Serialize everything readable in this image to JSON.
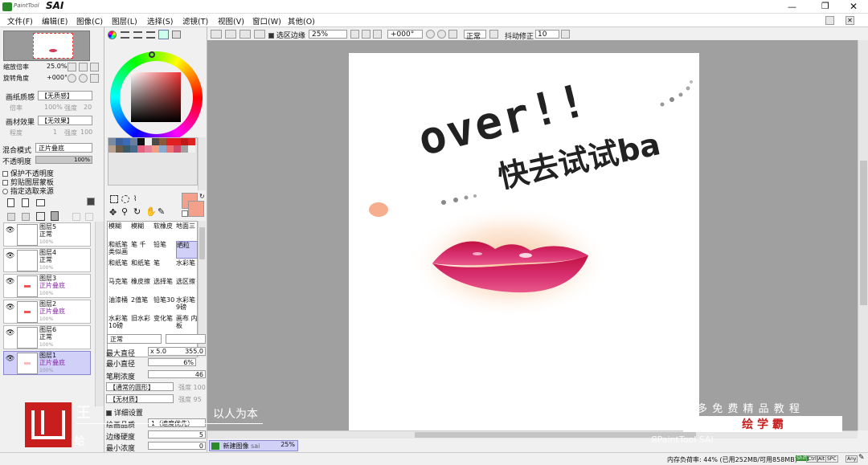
{
  "title": {
    "logo_small": "PaintTool",
    "logo_big": "SAI"
  },
  "menu": [
    "文件(F)",
    "编辑(E)",
    "图像(C)",
    "图层(L)",
    "选择(S)",
    "滤镜(T)",
    "视图(V)",
    "窗口(W)",
    "其他(O)"
  ],
  "navigator": {
    "zoom_label": "缩放倍率",
    "zoom_value": "25.0%",
    "rotate_label": "旋转角度",
    "rotate_value": "+000°"
  },
  "paper_texture": {
    "label": "画纸质感",
    "value": "【无质感】",
    "scale_label": "倍率",
    "scale_value": "100%",
    "strength_label": "强度",
    "strength_value": "20"
  },
  "paper_effect": {
    "label": "画材效果",
    "value": "【无效果】",
    "width_label": "程度",
    "width_value": "1",
    "strength_label": "强度",
    "strength_value": "100"
  },
  "blend": {
    "label": "混合模式",
    "value": "正片叠底",
    "opacity_label": "不透明度",
    "opacity_value": "100%"
  },
  "checks": [
    "保护不透明度",
    "剪贴图层蒙板",
    "指定选取来源"
  ],
  "layers": [
    {
      "name": "图层5",
      "mode": "正常",
      "opacity": "100%",
      "purple": false
    },
    {
      "name": "图层4",
      "mode": "正常",
      "opacity": "100%",
      "purple": false
    },
    {
      "name": "图层3",
      "mode": "正片叠底",
      "opacity": "100%",
      "purple": true
    },
    {
      "name": "图层2",
      "mode": "正片叠底",
      "opacity": "100%",
      "purple": true
    },
    {
      "name": "图层6",
      "mode": "正常",
      "opacity": "100%",
      "purple": false
    },
    {
      "name": "图层1",
      "mode": "正片叠底",
      "opacity": "100%",
      "purple": true
    }
  ],
  "tools": [
    [
      "模糊",
      "模糊",
      "软橡皮",
      "地面三"
    ],
    [
      "和纸笔 类似画",
      "笔 千",
      "铅笔",
      "晒粒"
    ],
    [
      "和纸笔",
      "和纸笔",
      "笔",
      "水彩笔"
    ],
    [
      "马克笔",
      "橡皮擦",
      "选择笔",
      "选区擦"
    ],
    [
      "油漆桶",
      "2值笔",
      "铅笔30",
      "水彩笔 9磅"
    ],
    [
      "水彩笔 10磅",
      "旧水彩",
      "变化笔",
      "画布 内板"
    ]
  ],
  "brush": {
    "mode": "正常",
    "max_size_label": "最大直径",
    "max_size_mult": "x 5.0",
    "max_size_value": "355.0",
    "min_size_label": "最小直径",
    "min_size_value": "6%",
    "density_label": "笔刷浓度",
    "density_value": "46",
    "shape_value": "【通常的圆形】",
    "shape_strength": "强度 100",
    "texture_value": "【无材质】",
    "texture_strength": "强度 95",
    "detail_label": "详细设置",
    "quality_label": "绘画品质",
    "quality_value": "1（速度优先）",
    "edge_label": "边缘硬度",
    "edge_value": "5",
    "min_density_label": "最小浓度",
    "min_density_value": "0"
  },
  "toolbar": {
    "selection_edge": "选区边缘",
    "zoom": "25%",
    "angle": "+000°",
    "mode": "正常",
    "stabilizer_label": "抖动修正",
    "stabilizer_value": "10"
  },
  "doc_tab": {
    "name": "新建图像",
    "zoom": "25%",
    "flag": "sai"
  },
  "status": {
    "memory": "内存负荷率: 44% (已用252MB/可用858MB)",
    "keys": [
      "Shift",
      "Ctrl",
      "Alt",
      "SPC",
      "Any"
    ]
  },
  "artwork": {
    "line1": "over!!",
    "line2": "快去试试ba"
  },
  "watermark": {
    "left_text": "王",
    "left_text2": "以人为本",
    "left_text3": "蛤",
    "right_text": "更 多 免 费 精 品 教 程",
    "right_badge": "绘 学 霸",
    "bottom_right": "ЯPaintTool SAI"
  },
  "colors": {
    "accent": "#d0d0f8",
    "purple_text": "#8a2aa8",
    "fg_color": "#f4a08a"
  }
}
